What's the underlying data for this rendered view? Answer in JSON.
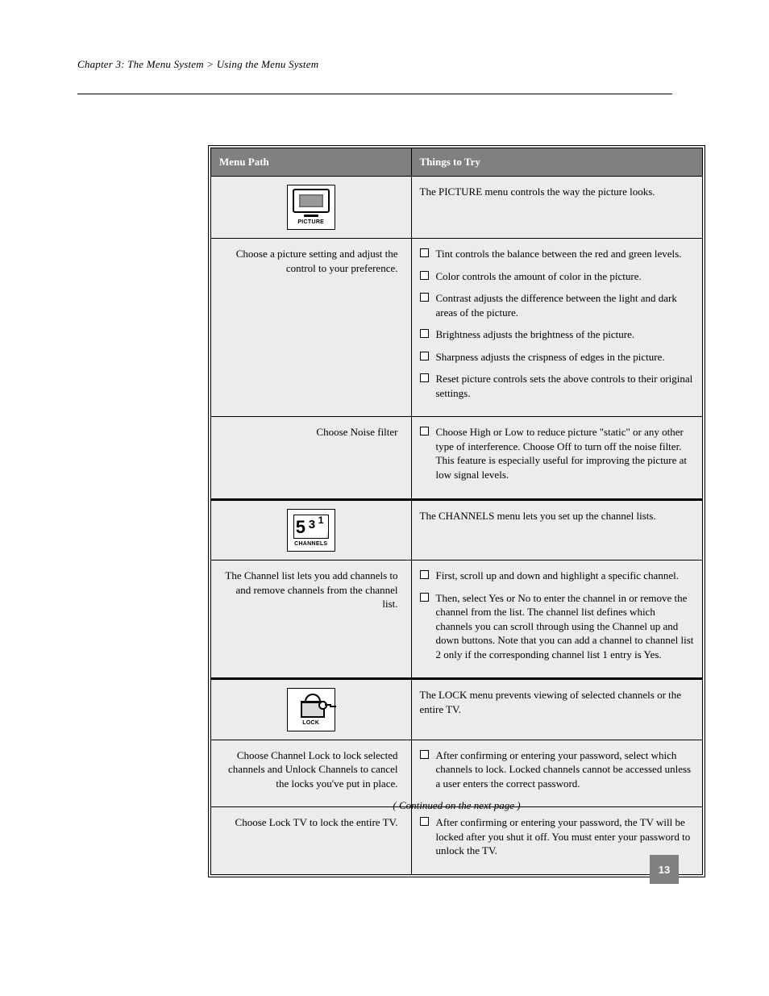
{
  "header": {
    "breadcrumb": "Chapter 3: The Menu System  >  Using the Menu System"
  },
  "table": {
    "columns": [
      "Menu Path",
      "Things to Try"
    ],
    "groups": [
      {
        "icon": "picture",
        "icon_label": "PICTURE",
        "heading_right": "The PICTURE menu controls the way the picture looks.",
        "rows": [
          {
            "label": "Choose a picture setting and adjust the control to your preference.",
            "items": [
              "Tint controls the balance between the red and green levels.",
              "Color controls the amount of color in the picture.",
              "Contrast adjusts the difference between the light and dark areas of the picture.",
              "Brightness adjusts the brightness of the picture.",
              "Sharpness adjusts the crispness of edges in the picture.",
              "Reset picture controls sets the above controls to their original settings."
            ]
          },
          {
            "label": "Choose Noise filter",
            "items": [
              "Choose High or Low to reduce picture \"static\" or any other type of interference. Choose Off to turn off the noise filter. This feature is especially useful for improving the picture at low signal levels."
            ]
          }
        ]
      },
      {
        "icon": "channels",
        "icon_label": "CHANNELS",
        "heading_right": "The CHANNELS menu lets you set up the channel lists.",
        "rows": [
          {
            "label": "The Channel list lets you add channels to and remove channels from the channel list.",
            "items": [
              "First, scroll up and down and highlight a specific channel.",
              "Then, select Yes or No to enter the channel in or remove the channel from the list. The channel list defines which channels you can scroll through using the Channel up and down buttons. Note that you can add a channel to channel list 2 only if the corresponding channel list 1 entry is Yes."
            ]
          }
        ]
      },
      {
        "icon": "lock",
        "icon_label": "LOCK",
        "heading_right": "The LOCK menu prevents viewing of selected channels or the entire TV.",
        "rows": [
          {
            "label": "Choose Channel Lock to lock selected channels and Unlock Channels to cancel the locks you've put in place.",
            "items": [
              "After confirming or entering your password, select which channels to lock. Locked channels cannot be accessed unless a user enters the correct password."
            ]
          },
          {
            "label": "Choose Lock TV to lock the entire TV.",
            "items": [
              "After confirming or entering your password, the TV will be locked after you shut it off. You must enter your password to unlock the TV."
            ]
          }
        ]
      }
    ]
  },
  "footer": {
    "continued": "( Continued on the next page )",
    "page_number": "13"
  }
}
